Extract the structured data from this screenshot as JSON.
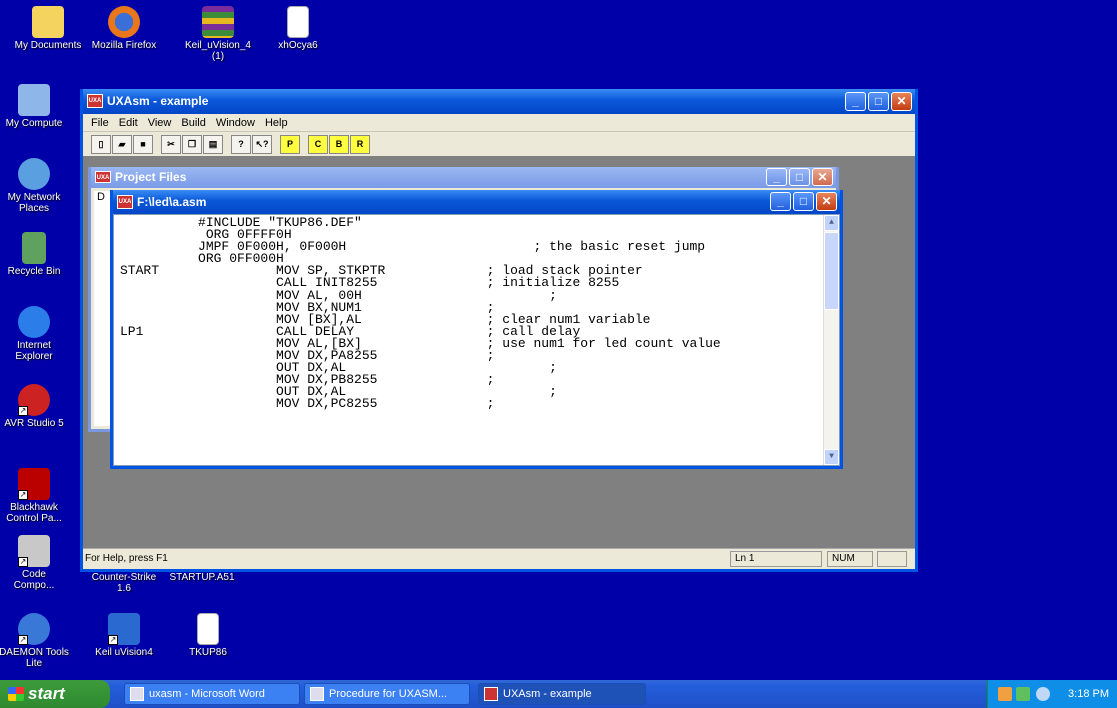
{
  "desktop": {
    "icons": [
      {
        "label": "My Documents",
        "icon": "my-documents-icon"
      },
      {
        "label": "Mozilla Firefox",
        "icon": "firefox-icon"
      },
      {
        "label": "Keil_uVision_4\n(1)",
        "icon": "winrar-archive-icon"
      },
      {
        "label": "xhOcya6",
        "icon": "image-file-icon"
      },
      {
        "label": "My Compute",
        "icon": "my-computer-icon"
      },
      {
        "label": "My Network\nPlaces",
        "icon": "network-places-icon"
      },
      {
        "label": "Recycle Bin",
        "icon": "recycle-bin-icon"
      },
      {
        "label": "Internet\nExplorer",
        "icon": "internet-explorer-icon"
      },
      {
        "label": "AVR Studio 5",
        "icon": "avr-studio-icon"
      },
      {
        "label": "Blackhawk\nControl Pa...",
        "icon": "blackhawk-icon"
      },
      {
        "label": "Code\nCompo...",
        "icon": "code-composer-icon"
      },
      {
        "label": "Counter-Strike\n1.6",
        "icon": "counter-strike-icon"
      },
      {
        "label": "STARTUP.A51",
        "icon": "asm-file-icon"
      },
      {
        "label": "DAEMON Tools\nLite",
        "icon": "daemon-tools-icon"
      },
      {
        "label": "Keil uVision4",
        "icon": "keil-icon"
      },
      {
        "label": "TKUP86",
        "icon": "text-file-icon"
      }
    ]
  },
  "app": {
    "title": "UXAsm - example",
    "menu": [
      "File",
      "Edit",
      "View",
      "Build",
      "Window",
      "Help"
    ],
    "toolbar": {
      "p": "P",
      "c": "C",
      "b": "B",
      "r": "R"
    },
    "status": {
      "help": "For Help, press F1",
      "ln": "Ln  1",
      "num": "NUM"
    }
  },
  "project_window": {
    "title": "Project Files",
    "content": "D"
  },
  "editor": {
    "title": "F:\\led\\a.asm",
    "lines": [
      "          #INCLUDE \"TKUP86.DEF\"",
      "           ORG 0FFFF0H",
      "          JMPF 0F000H, 0F000H                        ; the basic reset jump",
      "          ORG 0FF000H",
      "START               MOV SP, STKPTR             ; load stack pointer",
      "                    CALL INIT8255              ; initialize 8255",
      "                    MOV AL, 00H                        ;",
      "                    MOV BX,NUM1                ;",
      "                    MOV [BX],AL                ; clear num1 variable",
      "LP1                 CALL DELAY                 ; call delay",
      "                    MOV AL,[BX]                ; use num1 for led count value",
      "                    MOV DX,PA8255              ;",
      "                    OUT DX,AL                          ;",
      "                    MOV DX,PB8255              ;",
      "                    OUT DX,AL                          ;",
      "                    MOV DX,PC8255              ;"
    ]
  },
  "taskbar": {
    "start": "start",
    "tasks": [
      "uxasm - Microsoft Word",
      "Procedure for UXASM...",
      "UXAsm - example"
    ],
    "clock": "3:18 PM"
  }
}
